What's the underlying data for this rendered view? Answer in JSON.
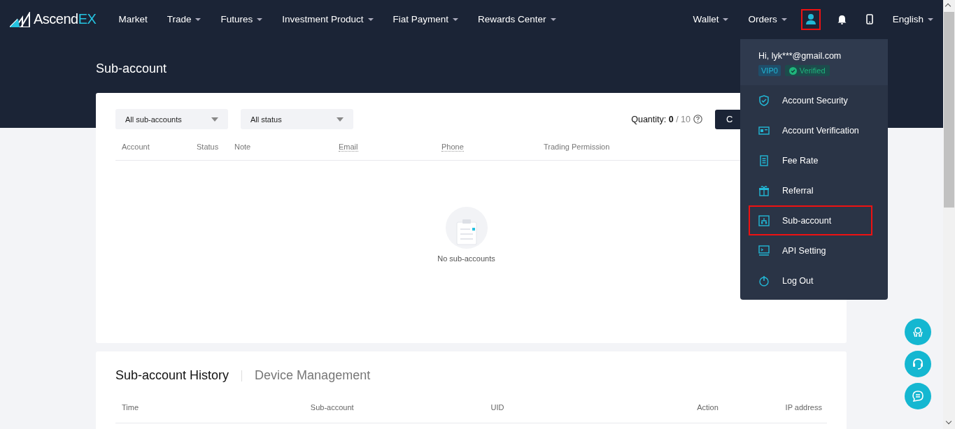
{
  "brand": {
    "name": "Ascend",
    "accent": "EX"
  },
  "nav": [
    {
      "label": "Market",
      "caret": false
    },
    {
      "label": "Trade",
      "caret": true
    },
    {
      "label": "Futures",
      "caret": true
    },
    {
      "label": "Investment Product",
      "caret": true
    },
    {
      "label": "Fiat Payment",
      "caret": true
    },
    {
      "label": "Rewards Center",
      "caret": true
    }
  ],
  "nav_right": [
    {
      "label": "Wallet",
      "caret": true
    },
    {
      "label": "Orders",
      "caret": true
    }
  ],
  "user_icon": {
    "highlighted": true
  },
  "language": {
    "label": "English",
    "caret": true
  },
  "page_title": "Sub-account",
  "filters": [
    {
      "value": "All sub-accounts"
    },
    {
      "value": "All status"
    }
  ],
  "quantity": {
    "label": "Quantity:",
    "used": "0",
    "total": "/ 10"
  },
  "create_button": "C",
  "table": {
    "columns": [
      {
        "label": "Account",
        "dotted": false
      },
      {
        "label": "Status",
        "dotted": false
      },
      {
        "label": "Note",
        "dotted": false
      },
      {
        "label": "Email",
        "dotted": true
      },
      {
        "label": "Phone",
        "dotted": true
      },
      {
        "label": "Trading Permission",
        "dotted": false
      }
    ],
    "empty_text": "No sub-accounts"
  },
  "history": {
    "tabs": [
      {
        "label": "Sub-account History",
        "selected": true
      },
      {
        "label": "Device Management",
        "selected": false
      }
    ],
    "columns": [
      "Time",
      "Sub-account",
      "UID",
      "Action",
      "IP address"
    ]
  },
  "menu": {
    "greeting": "Hi, lyk***@gmail.com",
    "vip": "VIP0",
    "verified": "Verified",
    "items": [
      {
        "label": "Account Security",
        "kind": "shield",
        "highlighted": false
      },
      {
        "label": "Account Verification",
        "kind": "card",
        "highlighted": false
      },
      {
        "label": "Fee Rate",
        "kind": "doc",
        "highlighted": false
      },
      {
        "label": "Referral",
        "kind": "gift",
        "highlighted": false
      },
      {
        "label": "Sub-account",
        "kind": "tree",
        "highlighted": true
      },
      {
        "label": "API Setting",
        "kind": "monitor",
        "highlighted": false
      },
      {
        "label": "Log Out",
        "kind": "power",
        "highlighted": false
      }
    ]
  }
}
